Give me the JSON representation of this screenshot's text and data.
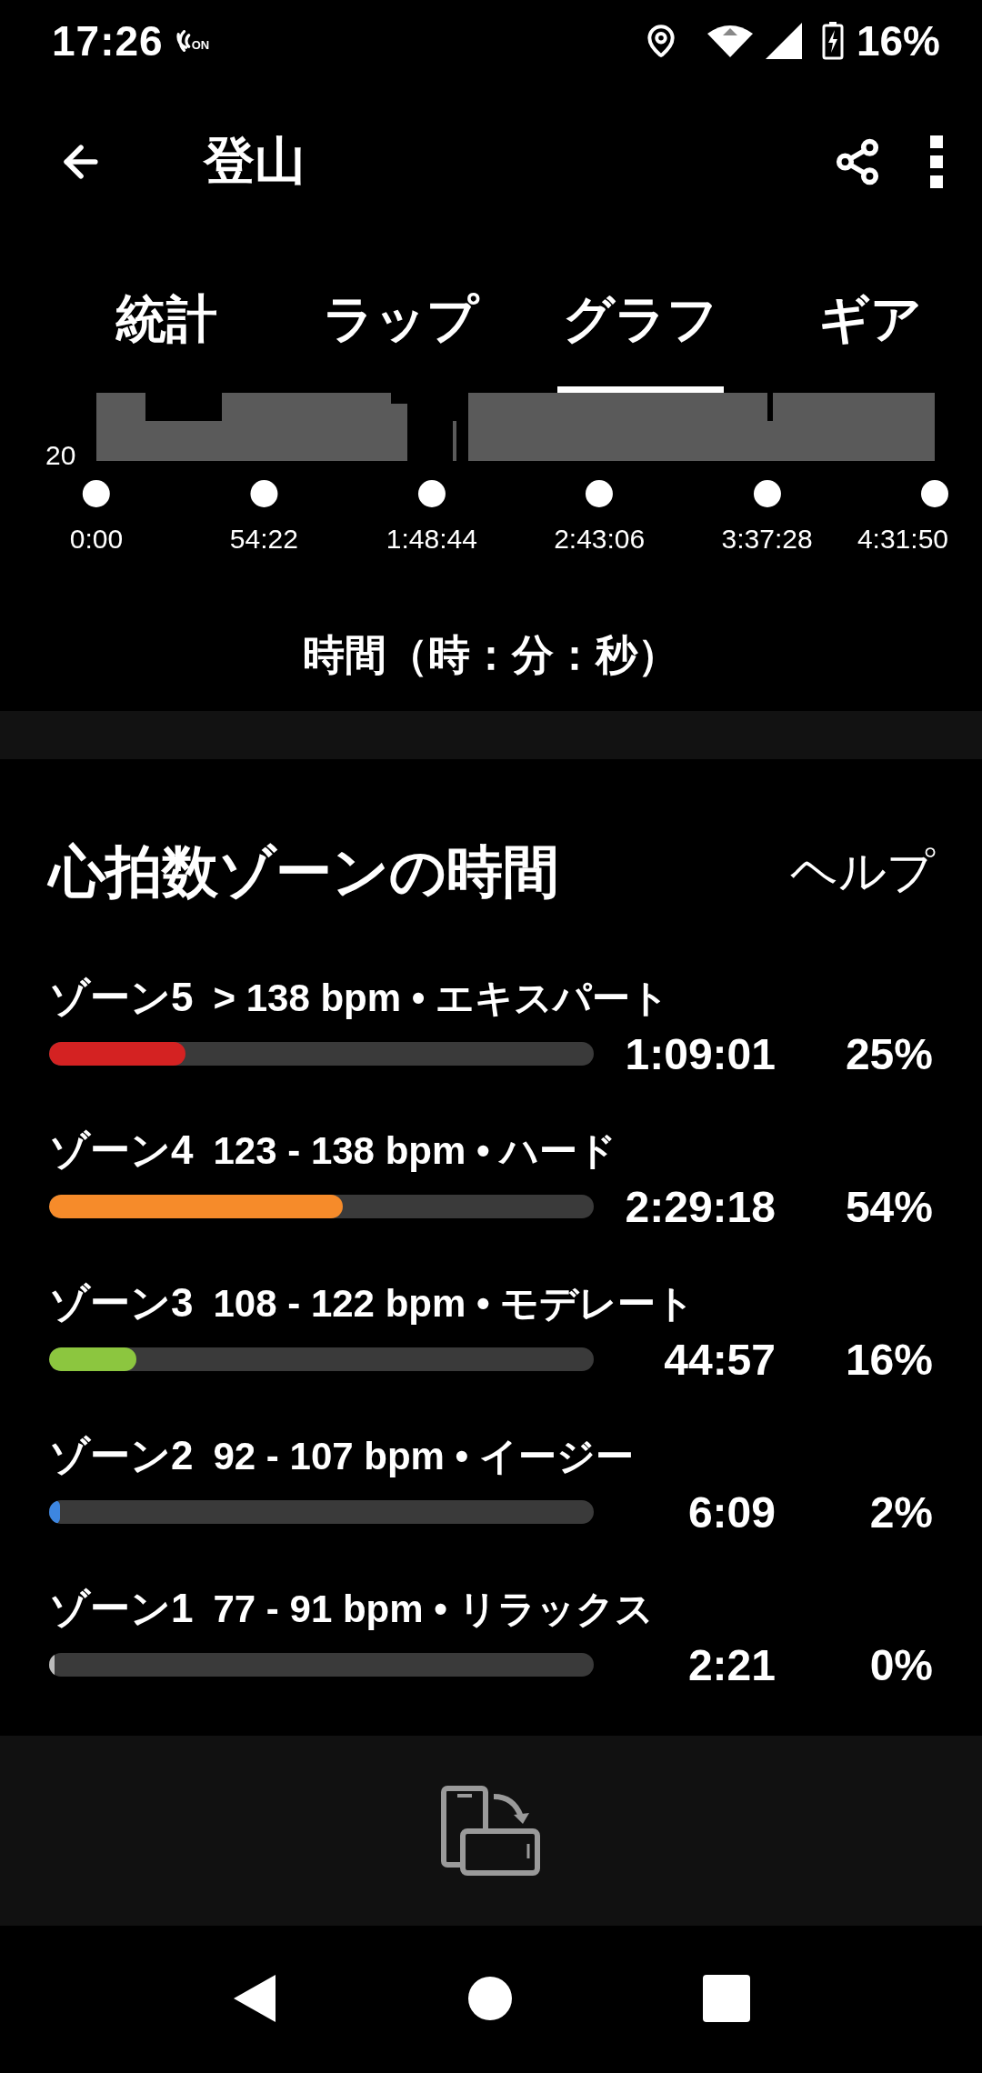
{
  "status_bar": {
    "time": "17:26",
    "nfc_label": "ON",
    "battery": "16%"
  },
  "app_bar": {
    "title": "登山"
  },
  "tabs": [
    {
      "label": "統計",
      "selected": false
    },
    {
      "label": "ラップ",
      "selected": false
    },
    {
      "label": "グラフ",
      "selected": true
    },
    {
      "label": "ギア",
      "selected": false
    }
  ],
  "graph": {
    "y_label": "20",
    "x_ticks": [
      "0:00",
      "54:22",
      "1:48:44",
      "2:43:06",
      "3:37:28",
      "4:31:50"
    ],
    "x_axis_title": "時間（時：分：秒）"
  },
  "heart_rate_zones": {
    "title": "心拍数ゾーンの時間",
    "help": "ヘルプ",
    "zones": [
      {
        "name": "ゾーン5",
        "range": "> 138 bpm • エキスパート",
        "time": "1:09:01",
        "percent": "25%",
        "level": 0.25,
        "color": "#d42222"
      },
      {
        "name": "ゾーン4",
        "range": "123 - 138 bpm • ハード",
        "time": "2:29:18",
        "percent": "54%",
        "level": 0.54,
        "color": "#f68b2a"
      },
      {
        "name": "ゾーン3",
        "range": "108 - 122 bpm • モデレート",
        "time": "44:57",
        "percent": "16%",
        "level": 0.16,
        "color": "#8cc63f"
      },
      {
        "name": "ゾーン2",
        "range": "92 - 107 bpm • イージー",
        "time": "6:09",
        "percent": "2%",
        "level": 0.02,
        "color": "#3d86e0"
      },
      {
        "name": "ゾーン1",
        "range": "77 - 91 bpm • リラックス",
        "time": "2:21",
        "percent": "0%",
        "level": 0.01,
        "color": "#bbbbbb"
      }
    ]
  }
}
